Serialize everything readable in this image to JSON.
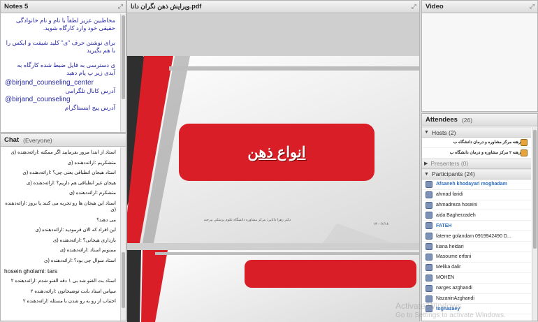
{
  "notes": {
    "title": "Notes 5",
    "lines": [
      "مخاطبین عزیز لطفاً با نام و نام خانوادگی حقیقی خود وارد کارگاه شوید.",
      "برای نوشتن حرف \"ی\" کلید شیفت و ایکس را با هم بگیرید",
      "ی دسترسی به فایل ضبط شده کارگاه به آیدی زیر پ پام دهید"
    ],
    "handle1": "@birjand_counseling_center",
    "handle1_label": "آدرس کانال تلگرامی",
    "handle2": "@birjand_counseling",
    "handle2_label": "آدرس پیج اینستاگرام"
  },
  "chat": {
    "title": "Chat",
    "scope": "(Everyone)",
    "messages": [
      "استاد از ابتدا مرور بفرمایید اگر ممکنه :ارائه‌دهنده (ی",
      "متشکریم :ارائه‌دهنده (ی",
      "استاد هیجان انطباقی یعنی چی؟ :ارائه‌دهنده (ی",
      "هیجان غیر انطباقی هم داریم؟ :ارائه‌دهنده (ی",
      "متشکرم :ارائه‌دهنده (ی",
      "استاد این هیجان ها رو تجربه می کنند یا بروز :ارائه‌دهنده (ی",
      "می دهند؟",
      "این افراد که الان فرمودید :ارائه‌دهنده (ی",
      "بازداری هیجانی؟ :ارائه‌دهنده (ی",
      "ممنونم استاد :ارائه‌دهنده (ی",
      "استاد سوال چی بود؟ :ارائه‌دهنده (ی",
      "hosein gholami: tars",
      "استاد بت الفنو شد بی ۱ دقه الفنو شدم :ارائه‌دهنده ۲",
      "سپاس استاد بابت توضیحاتون :ارائه‌دهنده ۲",
      "اجتناب از رو به رو شدن با مسئله :ارائه‌دهنده ۲"
    ]
  },
  "share": {
    "title": "ویرایش ذهن نگران دانا.pdf",
    "slide_title": "انواع ذهن",
    "slide_credit": "دکتر زهرا دانایی؛ مرکز مشاوره دانشگاه علوم پزشکی بیرجند",
    "slide_date": "۱۴۰۰/۱/۱۸",
    "colors": {
      "accent": "#d91e27",
      "dark": "#2f2f2f"
    }
  },
  "video": {
    "title": "Video"
  },
  "attendees": {
    "title": "Attendees",
    "count": "(26)",
    "hosts_label": "Hosts (2)",
    "hosts": [
      "رهنه مرکز مشاوره و درمان دانشگاه ب",
      "رهنه ۲ مرکز مشاوره و درمان دانشگاه ب"
    ],
    "presenters_label": "Presenters (0)",
    "participants_label": "Participants (24)",
    "participants": [
      {
        "name": "Afsaneh khodayari moghadam",
        "hl": true
      },
      {
        "name": "ahmad faridi",
        "hl": false
      },
      {
        "name": "ahmadreza hoseini",
        "hl": false
      },
      {
        "name": "aida Bagherzadeh",
        "hl": false
      },
      {
        "name": "FATEH",
        "hl": true
      },
      {
        "name": "fateme golandam 0919942490 D...",
        "hl": false
      },
      {
        "name": "kiana heidari",
        "hl": false
      },
      {
        "name": "Masoume erfani",
        "hl": false
      },
      {
        "name": "Melika dalir",
        "hl": false
      },
      {
        "name": "MOHEN",
        "hl": false
      },
      {
        "name": "narges azghandi",
        "hl": false
      },
      {
        "name": "NazaninAzghandi",
        "hl": false
      },
      {
        "name": "toghazaey",
        "hl": true
      }
    ]
  },
  "watermark": {
    "line1": "Activate Windows",
    "line2": "Go to Settings to activate Windows."
  }
}
